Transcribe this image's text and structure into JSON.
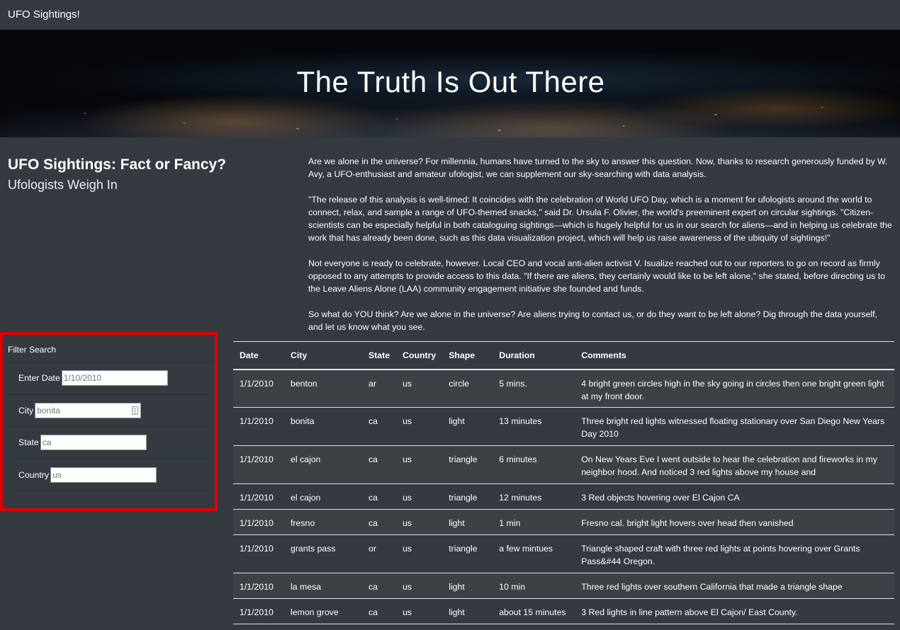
{
  "navbar": {
    "brand": "UFO Sightings!"
  },
  "hero": {
    "title": "The Truth Is Out There"
  },
  "heading": {
    "main": "UFO Sightings: Fact or Fancy?",
    "sub": "Ufologists Weigh In"
  },
  "intro": [
    "Are we alone in the universe? For millennia, humans have turned to the sky to answer this question. Now, thanks to research generously funded by W. Avy, a UFO-enthusiast and amateur ufologist, we can supplement our sky-searching with data analysis.",
    "\"The release of this analysis is well-timed: It coincides with the celebration of World UFO Day, which is a moment for ufologists around the world to connect, relax, and sample a range of UFO-themed snacks,\" said Dr. Ursula F. Olivier, the world's preeminent expert on circular sightings. \"Citizen-scientists can be especially helpful in both cataloguing sightings—which is hugely helpful for us in our search for aliens—and in helping us celebrate the work that has already been done, such as this data visualization project, which will help us raise awareness of the ubiquity of sightings!\"",
    "Not everyone is ready to celebrate, however. Local CEO and vocal anti-alien activist V. Isualize reached out to our reporters to go on record as firmly opposed to any attempts to provide access to this data. \"If there are aliens, they certainly would like to be left alone,\" she stated, before directing us to the Leave Aliens Alone (LAA) community engagement initiative she founded and funds.",
    "So what do YOU think? Are we alone in the universe? Are aliens trying to contact us, or do they want to be left alone? Dig through the data yourself, and let us know what you see."
  ],
  "filters": {
    "title": "Filter Search",
    "date": {
      "label": "Enter Date",
      "value": "",
      "placeholder": "1/10/2010"
    },
    "city": {
      "label": "City",
      "value": "",
      "placeholder": "bonita"
    },
    "state": {
      "label": "State",
      "value": "",
      "placeholder": "ca"
    },
    "country": {
      "label": "Country",
      "value": "",
      "placeholder": "us"
    }
  },
  "table": {
    "headers": [
      "Date",
      "City",
      "State",
      "Country",
      "Shape",
      "Duration",
      "Comments"
    ],
    "rows": [
      [
        "1/1/2010",
        "benton",
        "ar",
        "us",
        "circle",
        "5 mins.",
        "4 bright green circles high in the sky going in circles then one bright green light at my front door."
      ],
      [
        "1/1/2010",
        "bonita",
        "ca",
        "us",
        "light",
        "13 minutes",
        "Three bright red lights witnessed floating stationary over San Diego New Years Day 2010"
      ],
      [
        "1/1/2010",
        "el cajon",
        "ca",
        "us",
        "triangle",
        "6 minutes",
        "On New Years Eve I went outside to hear the celebration and fireworks in my neighbor hood. And noticed 3 red lights above my house and"
      ],
      [
        "1/1/2010",
        "el cajon",
        "ca",
        "us",
        "triangle",
        "12 minutes",
        "3 Red objects hovering over El Cajon CA"
      ],
      [
        "1/1/2010",
        "fresno",
        "ca",
        "us",
        "light",
        "1 min",
        "Fresno cal. bright light hovers over head then vanished"
      ],
      [
        "1/1/2010",
        "grants pass",
        "or",
        "us",
        "triangle",
        "a few mintues",
        "Triangle shaped craft with three red lights at points hovering over Grants Pass&#44 Oregon."
      ],
      [
        "1/1/2010",
        "la mesa",
        "ca",
        "us",
        "light",
        "10 min",
        "Three red lights over southern California that made a triangle shape"
      ],
      [
        "1/1/2010",
        "lemon grove",
        "ca",
        "us",
        "light",
        "about 15 minutes",
        "3 Red lights in line pattern above El Cajon/ East County."
      ]
    ]
  }
}
